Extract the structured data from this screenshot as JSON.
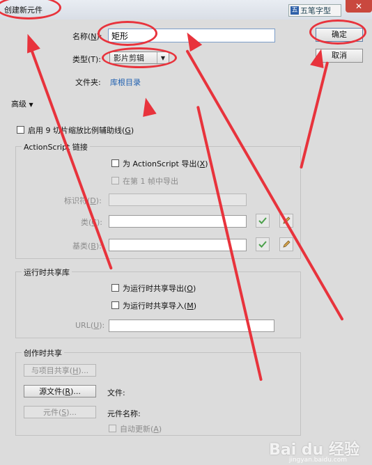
{
  "window": {
    "title": "创建新元件",
    "ime_label": "五笔字型",
    "close_label": "✕"
  },
  "form": {
    "name_label": "名称(",
    "name_key": "N",
    "name_label_end": "):",
    "name_value": "矩形",
    "type_label": "类型(T):",
    "type_value": "影片剪辑",
    "folder_label": "文件夹:",
    "folder_link": "库根目录",
    "ok_label": "确定",
    "cancel_label": "取消",
    "advanced_label": "高级"
  },
  "guides": {
    "label": "启用 9 切片缩放比例辅助线(",
    "key": "G",
    "end": ")"
  },
  "actionscript": {
    "group_title": "ActionScript 链接",
    "export_as": "为 ActionScript 导出(",
    "export_as_key": "X",
    "export_frame": "在第 1 帧中导出",
    "identifier_label": "标识符(",
    "identifier_key": "D",
    "class_label": "类(",
    "class_key": "C",
    "base_class_label": "基类(",
    "base_class_key": "B",
    "end": "):"
  },
  "runtime": {
    "group_title": "运行时共享库",
    "export_label": "为运行时共享导出(",
    "export_key": "O",
    "import_label": "为运行时共享导入(",
    "import_key": "M",
    "url_label": "URL(",
    "url_key": "U",
    "end": ")"
  },
  "authortime": {
    "group_title": "创作时共享",
    "share_btn": "与项目共享(",
    "share_key": "H",
    "source_btn": "源文件(",
    "source_key": "R",
    "btn_end": ")...",
    "file_label": "文件:",
    "symbol_btn": "元件(",
    "symbol_key": "S",
    "symbol_name_label": "元件名称:",
    "auto_update": "自动更新(",
    "auto_update_key": "A"
  },
  "watermark": {
    "text": "Bai du 经验",
    "sub": "jingyan.baidu.com"
  },
  "colors": {
    "annotation": "#e8333c",
    "link": "#1e5fb0"
  },
  "icons": [
    "check-icon",
    "pencil-icon",
    "dropdown-arrow-icon",
    "close-icon",
    "triangle-down-icon"
  ]
}
